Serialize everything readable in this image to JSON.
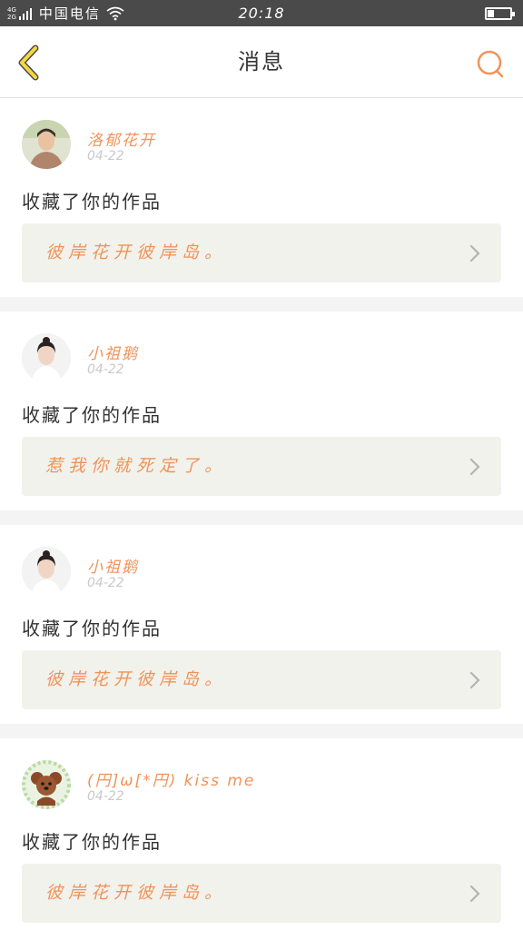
{
  "status_bar": {
    "network_top": "4G",
    "network_bottom": "2G",
    "carrier": "中国电信",
    "time": "20:18",
    "battery_level": 0.25
  },
  "header": {
    "title": "消息",
    "back_icon": "chevron-left-icon",
    "search_icon": "search-icon",
    "accent_back": "#f5d742",
    "accent_search": "#f0935a"
  },
  "messages": [
    {
      "username": "洛郁花开",
      "date": "04-22",
      "action": "收藏了你的作品",
      "work_title": "彼岸花开彼岸岛。",
      "avatar": "avatar-man"
    },
    {
      "username": "小祖鹅",
      "date": "04-22",
      "action": "收藏了你的作品",
      "work_title": "惹我你就死定了。",
      "avatar": "avatar-woman"
    },
    {
      "username": "小祖鹅",
      "date": "04-22",
      "action": "收藏了你的作品",
      "work_title": "彼岸花开彼岸岛。",
      "avatar": "avatar-woman"
    },
    {
      "username": "(円]ω[*円) kiss me",
      "date": "04-22",
      "action": "收藏了你的作品",
      "work_title": "彼岸花开彼岸岛。",
      "avatar": "avatar-dog"
    }
  ],
  "colors": {
    "accent": "#f0935a",
    "date": "#c9c9c9",
    "card_bg": "#f2f2ec",
    "separator": "#f4f4f4"
  }
}
